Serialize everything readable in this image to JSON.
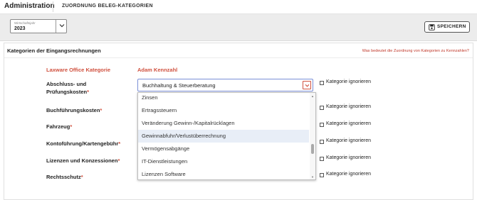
{
  "header": {
    "app_title": "Administration",
    "page_title": "ZUORDNUNG BELEG-KATEGORIEN"
  },
  "toolbar": {
    "year_caption": "Wirtschaftsjahr",
    "year_value": "2023",
    "save_label": "SPEICHERN"
  },
  "section": {
    "title": "Kategorien der Eingangsrechnungen",
    "help_link": "Was bedeutet die Zuordnung von Kategorien zu Kennzahlen?",
    "col_category": "Laxware Office Kategorie",
    "col_kennzahl": "Adam Kennzahl"
  },
  "rows": [
    {
      "label_line1": "Abschluss- und",
      "label_line2": "Prüfungskosten",
      "required": "*",
      "ignore_label": "Kategorie ignorieren"
    },
    {
      "label_line1": "Buchführungskosten",
      "required": "*",
      "ignore_label": "Kategorie ignorieren"
    },
    {
      "label_line1": "Fahrzeug",
      "required": "*",
      "ignore_label": "Kategorie ignorieren"
    },
    {
      "label_line1": "Kontoführung/Kartengebühr",
      "required": "*",
      "ignore_label": "Kategorie ignorieren"
    },
    {
      "label_line1": "Lizenzen und Konzessionen",
      "required": "*",
      "ignore_label": "Kategorie ignorieren"
    },
    {
      "label_line1": "Rechtsschutz",
      "required": "*",
      "ignore_label": "Kategorie ignorieren"
    }
  ],
  "combo": {
    "value": "Buchhaltung & Steuerberatung"
  },
  "dropdown": {
    "options": [
      "Zinsen",
      "Ertragssteuern",
      "Veränderung Gewinn-/Kapitalrücklagen",
      "Gewinnabfuhr/Verlustüberrechnung",
      "Vermögensabgänge",
      "IT-Dienstleistungen",
      "Lizenzen Software"
    ],
    "selected_index": 3
  },
  "colors": {
    "accent": "#d0513f",
    "focus_border": "#7b8fd6",
    "selected_row": "#e8eef7"
  }
}
